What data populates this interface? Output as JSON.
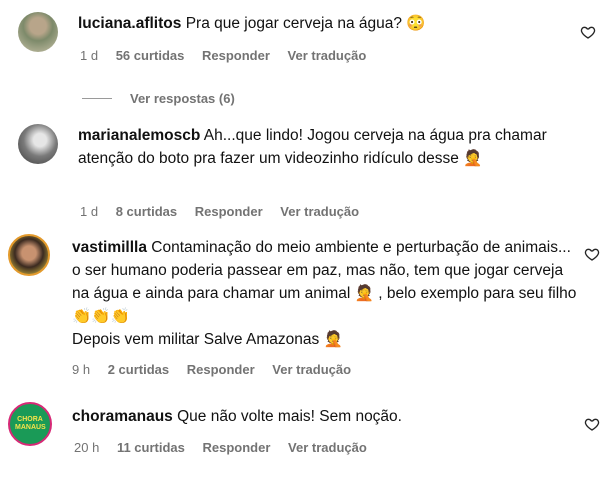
{
  "comments": [
    {
      "username": "luciana.aflitos",
      "text": "Pra que jogar cerveja na água? 😳",
      "time": "1 d",
      "likes": "56 curtidas",
      "reply": "Responder",
      "translate": "Ver tradução",
      "view_replies": "Ver respostas (6)"
    },
    {
      "username": "marianalemoscb",
      "text": "Ah...que lindo! Jogou cerveja na água pra chamar atenção do boto pra fazer um videozinho ridículo desse 🤦",
      "time": "1 d",
      "likes": "8 curtidas",
      "reply": "Responder",
      "translate": "Ver tradução"
    },
    {
      "username": "vastimillla",
      "text_line1": "Contaminação do meio ambiente e perturbação de animais... o ser humano poderia passear em paz, mas não, tem que jogar cerveja na água e ainda para chamar um animal 🤦 , belo exemplo para seu filho 👏👏👏",
      "text_line2": "Depois vem militar Salve Amazonas 🤦",
      "time": "9 h",
      "likes": "2 curtidas",
      "reply": "Responder",
      "translate": "Ver tradução"
    },
    {
      "username": "choramanaus",
      "text": "Que não volte mais! Sem noção.",
      "time": "20 h",
      "likes": "11 curtidas",
      "reply": "Responder",
      "translate": "Ver tradução",
      "avatar_label": "CHORA MANAUS"
    }
  ],
  "icons": {
    "like": "heart-outline-icon"
  },
  "colors": {
    "meta": "#737373",
    "choramanaus_avatar": "#1a9a57"
  }
}
